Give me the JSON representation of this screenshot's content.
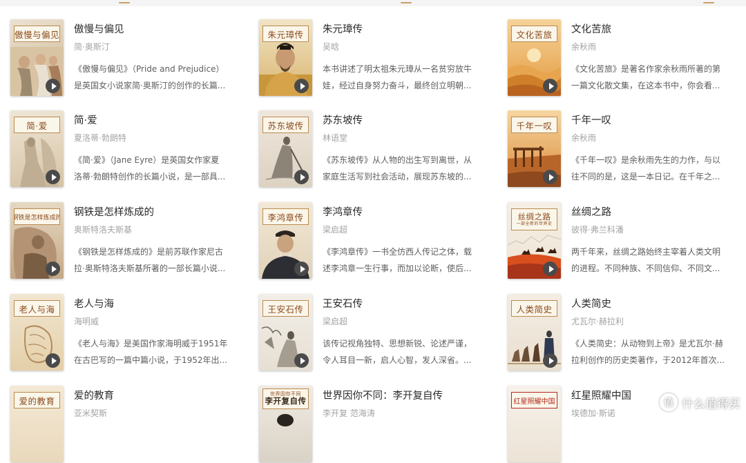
{
  "books": [
    {
      "title": "傲慢与偏见",
      "author": "简·奥斯汀",
      "desc1": "《傲慢与偏见》（Pride and Prejudice）",
      "desc2": "是英国女小说家简·奥斯汀的创作的长篇...",
      "cover_label": "傲慢与偏见",
      "cover_sub": ""
    },
    {
      "title": "朱元璋传",
      "author": "吴晗",
      "desc1": "本书讲述了明太祖朱元璋从一名贫穷放牛",
      "desc2": "娃，经过自身努力奋斗，最终创立明朝...",
      "cover_label": "朱元璋传",
      "cover_sub": ""
    },
    {
      "title": "文化苦旅",
      "author": "余秋雨",
      "desc1": "《文化苦旅》是著名作家余秋雨所著的第",
      "desc2": "一篇文化散文集，在这本书中，你会看...",
      "cover_label": "文化苦旅",
      "cover_sub": ""
    },
    {
      "title": "简·爱",
      "author": "夏洛蒂·勃朗特",
      "desc1": "《简·爱》（Jane Eyre）是英国女作家夏",
      "desc2": "洛蒂·勃朗特创作的长篇小说，是一部具...",
      "cover_label": "简·爱",
      "cover_sub": ""
    },
    {
      "title": "苏东坡传",
      "author": "林语堂",
      "desc1": "《苏东坡传》从人物的出生写到离世，从",
      "desc2": "家庭生活写到社会活动，展现苏东坡的...",
      "cover_label": "苏东坡传",
      "cover_sub": ""
    },
    {
      "title": "千年一叹",
      "author": "余秋雨",
      "desc1": "《千年一叹》是余秋雨先生的力作，与以",
      "desc2": "往不同的是，这是一本日记。在千年之...",
      "cover_label": "千年一叹",
      "cover_sub": ""
    },
    {
      "title": "钢铁是怎样炼成的",
      "author": "奥斯特洛夫斯基",
      "desc1": "《钢铁是怎样炼成的》是前苏联作家尼古",
      "desc2": "拉·奥斯特洛夫斯基所著的一部长篇小说...",
      "cover_label": "钢铁是怎样炼成的",
      "cover_sub": ""
    },
    {
      "title": "李鸿章传",
      "author": "梁启超",
      "desc1": "《李鸿章传》一书全仿西人传记之体，载",
      "desc2": "述李鸿章一生行事，而加以论断，使后...",
      "cover_label": "李鸿章传",
      "cover_sub": ""
    },
    {
      "title": "丝绸之路",
      "author": "彼得·弗兰科潘",
      "desc1": "两千年来，丝绸之路始终主宰着人类文明",
      "desc2": "的进程。不同种族、不同信仰、不同文...",
      "cover_label": "丝绸之路",
      "cover_sub": "一部全新的世界史"
    },
    {
      "title": "老人与海",
      "author": "海明威",
      "desc1": "《老人与海》是美国作家海明威于1951年",
      "desc2": "在古巴写的一篇中篇小说，于1952年出...",
      "cover_label": "老人与海",
      "cover_sub": ""
    },
    {
      "title": "王安石传",
      "author": "梁启超",
      "desc1": "该传记视角独特、思想新锐、论述严谨，",
      "desc2": "令人耳目一新，启人心智，发人深省。...",
      "cover_label": "王安石传",
      "cover_sub": ""
    },
    {
      "title": "人类简史",
      "author": "尤瓦尔·赫拉利",
      "desc1": "《人类简史：从动物到上帝》是尤瓦尔·赫",
      "desc2": "拉利创作的历史类著作，于2012年首次...",
      "cover_label": "人类简史",
      "cover_sub": ""
    },
    {
      "title": "爱的教育",
      "author": "亚米契斯",
      "desc1": "",
      "desc2": "",
      "cover_label": "爱的教育",
      "cover_sub": ""
    },
    {
      "title": "世界因你不同：李开复自传",
      "author": "李开复 范海涛",
      "desc1": "",
      "desc2": "",
      "cover_label": "李开复自传",
      "cover_sub": "世界因你不同"
    },
    {
      "title": "红星照耀中国",
      "author": "埃德加·斯诺",
      "desc1": "",
      "desc2": "",
      "cover_label": "红星照耀中国",
      "cover_sub": ""
    }
  ],
  "watermark": {
    "logo": "值",
    "text": "什么值得买"
  },
  "colors": {
    "accent": "#c9a063",
    "play_button": "#4a4a4a",
    "title_text": "#2a2a2a",
    "author_text": "#a3a3a3",
    "desc_text": "#5e5e5e"
  }
}
